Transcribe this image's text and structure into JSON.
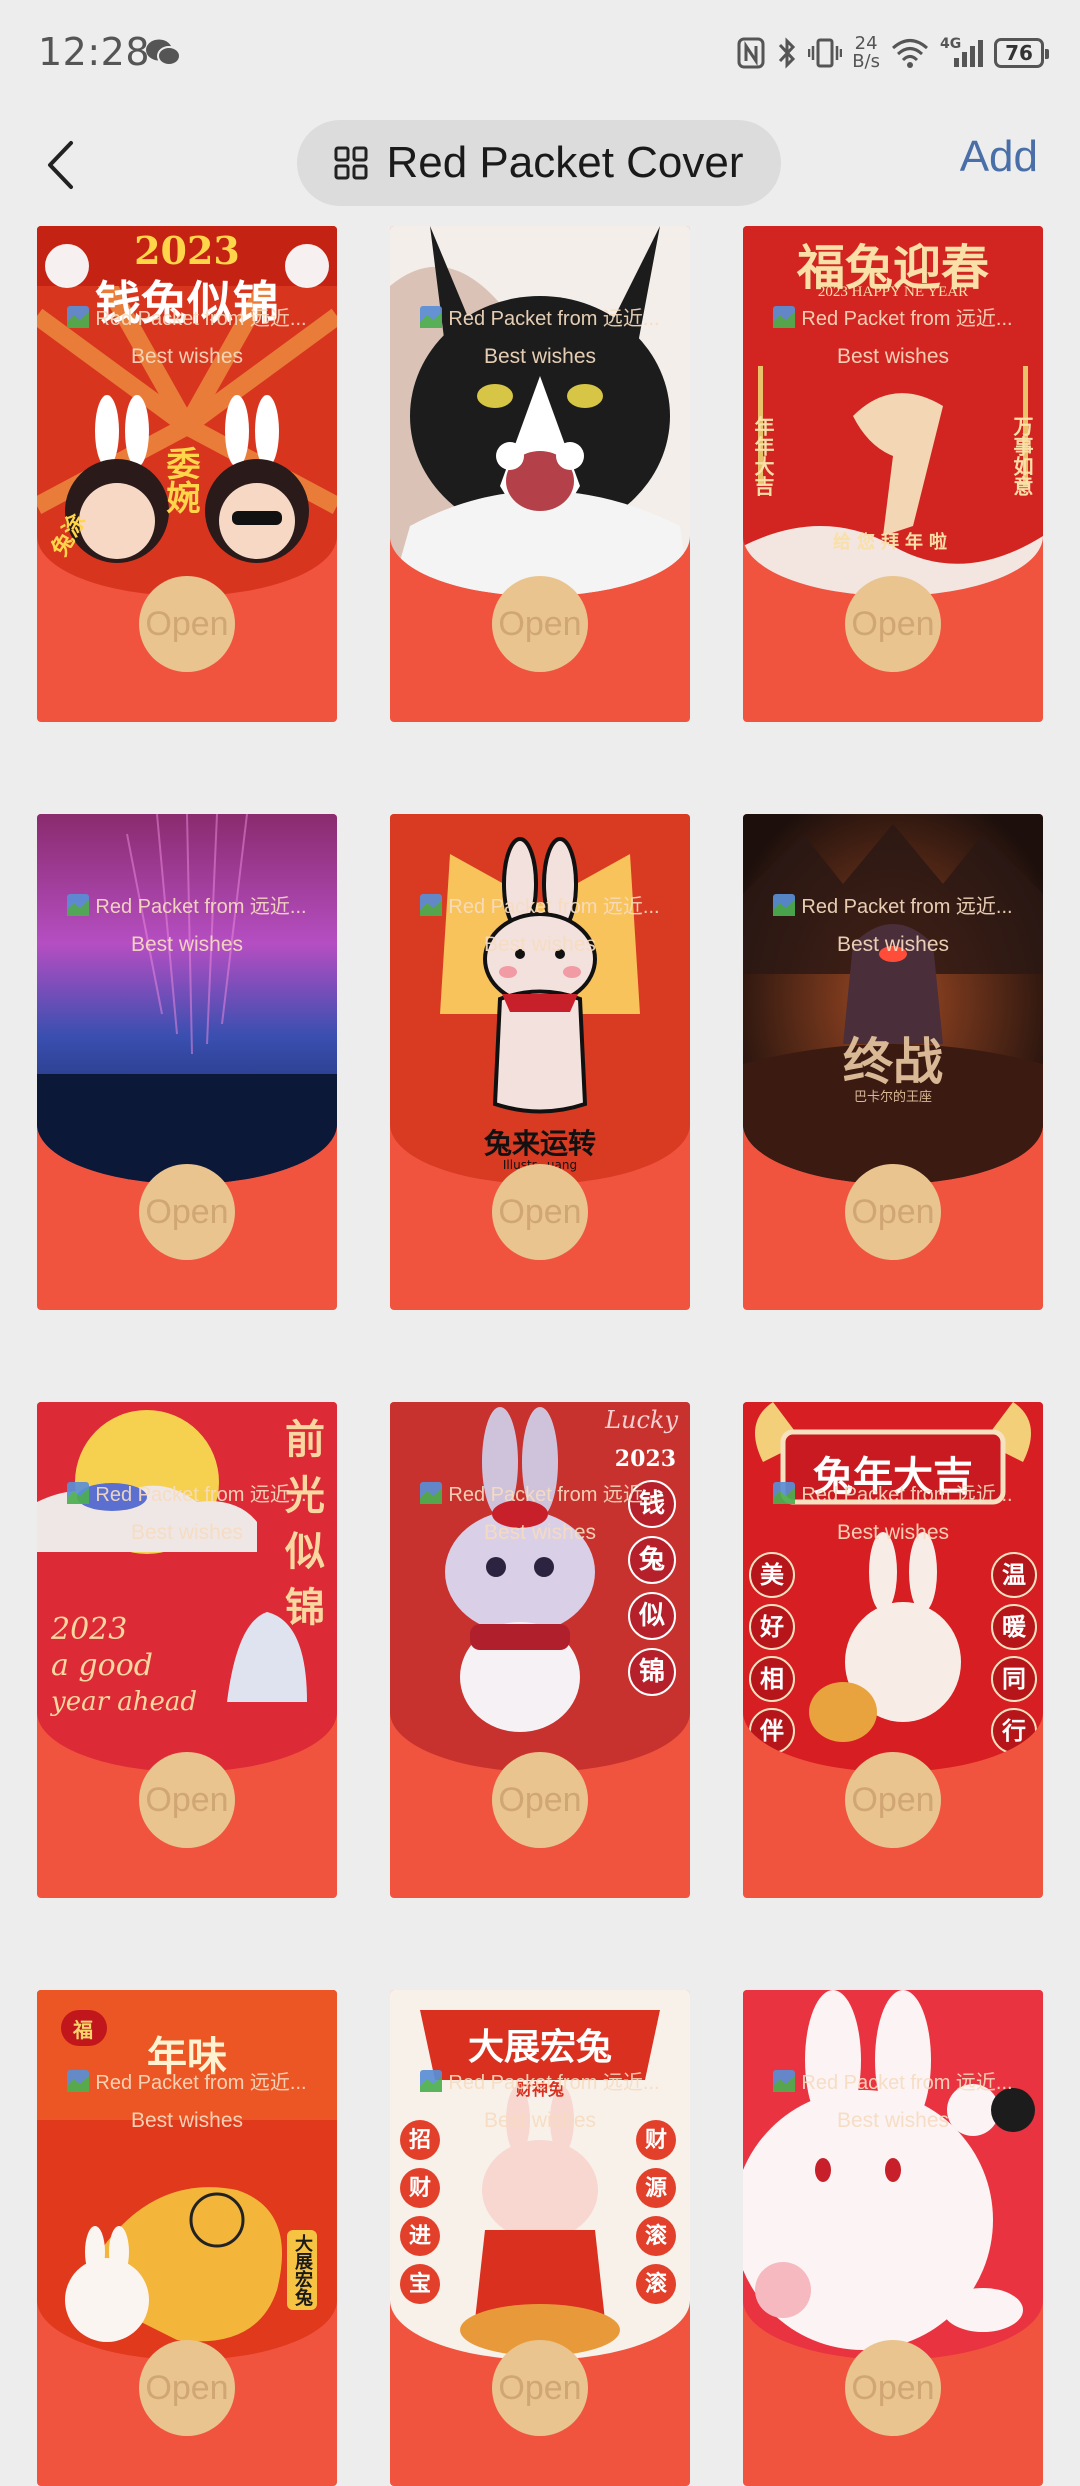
{
  "status_bar": {
    "time": "12:28",
    "net_speed_value": "24",
    "net_speed_unit": "B/s",
    "network_type": "4G",
    "battery": "76"
  },
  "header": {
    "title": "Red Packet Cover",
    "add_label": "Add"
  },
  "cards": [
    {
      "from": "Red Packet from 远近...",
      "wishes": "Best wishes",
      "open": "Open",
      "art": [
        "2023",
        "钱兔似锦",
        "委婉",
        "兔涂"
      ],
      "icon": "rabbit-couple-art"
    },
    {
      "from": "Red Packet from 远近...",
      "wishes": "Best wishes",
      "open": "Open",
      "art": [],
      "icon": "cat-art"
    },
    {
      "from": "Red Packet from 远近...",
      "wishes": "Best wishes",
      "open": "Open",
      "art": [
        "福兔迎春",
        "2023 HAPPY NE YEAR",
        "年年大吉",
        "万事如意",
        "给您拜年啦"
      ],
      "icon": "rabbit-emblem-art"
    },
    {
      "from": "Red Packet from 远近...",
      "wishes": "Best wishes",
      "open": "Open",
      "art": [],
      "icon": "aurora-art"
    },
    {
      "from": "Red Packet from 远近...",
      "wishes": "Best wishes",
      "open": "Open",
      "art": [
        "兔来运转",
        "Illustr...uang"
      ],
      "icon": "cartoon-rabbit-art"
    },
    {
      "from": "Red Packet from 远近...",
      "wishes": "Best wishes",
      "open": "Open",
      "art": [
        "终战",
        "巴卡尔的王座"
      ],
      "icon": "game-art"
    },
    {
      "from": "Red Packet from 远近...",
      "wishes": "Best wishes",
      "open": "Open",
      "art": [
        "前",
        "光",
        "似",
        "锦",
        "2023",
        "a good",
        "year ahead"
      ],
      "icon": "moon-rabbit-art"
    },
    {
      "from": "Red Packet from 远近...",
      "wishes": "Best wishes",
      "open": "Open",
      "art": [
        "Lucky",
        "2023",
        "钱",
        "兔",
        "似",
        "锦"
      ],
      "icon": "bunny-doll-art"
    },
    {
      "from": "Red Packet from 远近...",
      "wishes": "Best wishes",
      "open": "Open",
      "art": [
        "兔年大吉",
        "美",
        "好",
        "相",
        "伴",
        "温",
        "暖",
        "同",
        "行"
      ],
      "icon": "rabbit-mascot-art"
    },
    {
      "from": "Red Packet from 远近...",
      "wishes": "Best wishes",
      "open": "Open",
      "art": [
        "年味",
        "大展宏兔",
        "福"
      ],
      "icon": "dragon-art"
    },
    {
      "from": "Red Packet from 远近...",
      "wishes": "Best wishes",
      "open": "Open",
      "art": [
        "大展宏兔",
        "财神兔",
        "招",
        "财",
        "进",
        "宝",
        "财",
        "源",
        "滚",
        "滚"
      ],
      "icon": "fortune-rabbit-art"
    },
    {
      "from": "Red Packet from 远近...",
      "wishes": "Best wishes",
      "open": "Open",
      "art": [],
      "icon": "white-rabbit-art"
    }
  ]
}
